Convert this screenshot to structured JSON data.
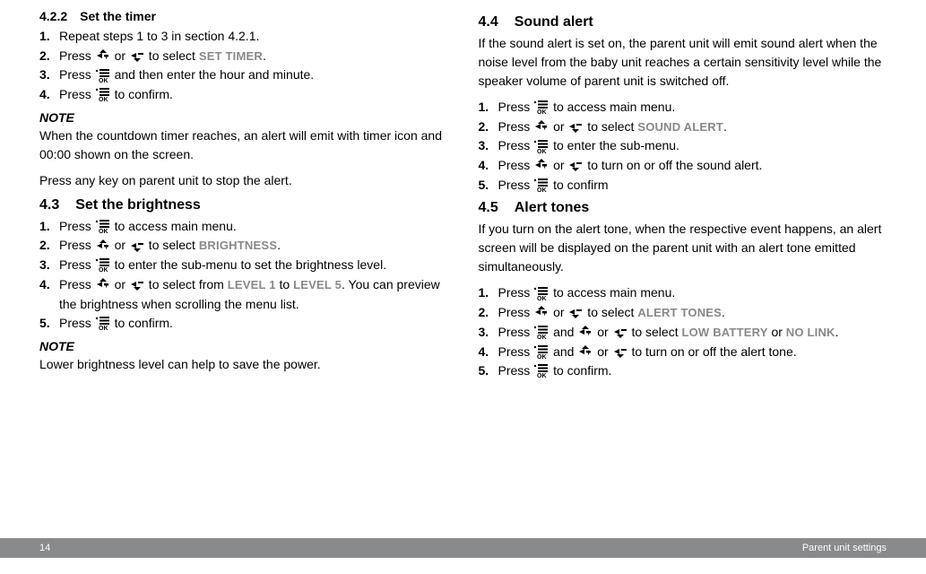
{
  "left": {
    "s422": {
      "num": "4.2.2",
      "title": "Set the timer",
      "steps": [
        {
          "n": "1.",
          "parts": [
            {
              "t": "Repeat steps 1 to 3 in section 4.2.1."
            }
          ]
        },
        {
          "n": "2.",
          "parts": [
            {
              "t": "Press "
            },
            {
              "icon": "up"
            },
            {
              "t": " or "
            },
            {
              "icon": "down"
            },
            {
              "t": " to select "
            },
            {
              "m": "SET TIMER"
            },
            {
              "t": "."
            }
          ]
        },
        {
          "n": "3.",
          "parts": [
            {
              "t": "Press "
            },
            {
              "icon": "ok"
            },
            {
              "t": " and then enter the hour and minute."
            }
          ]
        },
        {
          "n": "4.",
          "parts": [
            {
              "t": "Press "
            },
            {
              "icon": "ok"
            },
            {
              "t": " to confirm."
            }
          ]
        }
      ],
      "noteLabel": "NOTE",
      "noteText": "When the countdown timer reaches, an alert will emit with timer icon and 00:00 shown on the screen.",
      "noteText2": "Press any key on parent unit to stop the alert."
    },
    "s43": {
      "num": "4.3",
      "title": "Set the brightness",
      "steps": [
        {
          "n": "1.",
          "parts": [
            {
              "t": "Press "
            },
            {
              "icon": "ok"
            },
            {
              "t": " to access main menu."
            }
          ]
        },
        {
          "n": "2.",
          "parts": [
            {
              "t": "Press "
            },
            {
              "icon": "up"
            },
            {
              "t": " or "
            },
            {
              "icon": "down"
            },
            {
              "t": " to select "
            },
            {
              "m": "BRIGHTNESS"
            },
            {
              "t": "."
            }
          ]
        },
        {
          "n": "3.",
          "parts": [
            {
              "t": "Press "
            },
            {
              "icon": "ok"
            },
            {
              "t": " to enter the sub-menu to set the brightness level."
            }
          ]
        },
        {
          "n": "4.",
          "parts": [
            {
              "t": "Press "
            },
            {
              "icon": "up"
            },
            {
              "t": " or "
            },
            {
              "icon": "down"
            },
            {
              "t": " to select from "
            },
            {
              "m": "LEVEL 1"
            },
            {
              "t": " to "
            },
            {
              "m": "LEVEL 5"
            },
            {
              "t": ". You can preview the brightness when scrolling the menu list."
            }
          ]
        },
        {
          "n": "5.",
          "parts": [
            {
              "t": "Press "
            },
            {
              "icon": "ok"
            },
            {
              "t": " to confirm."
            }
          ]
        }
      ],
      "noteLabel": "NOTE",
      "noteText": "Lower brightness level can help to save the power."
    }
  },
  "right": {
    "s44": {
      "num": "4.4",
      "title": "Sound alert",
      "intro": "If the sound alert is set on, the parent unit will emit sound alert when the noise level from the baby unit reaches a certain sensitivity level while the speaker volume of parent unit is switched off.",
      "steps": [
        {
          "n": "1.",
          "parts": [
            {
              "t": "Press "
            },
            {
              "icon": "ok"
            },
            {
              "t": " to access main menu."
            }
          ]
        },
        {
          "n": "2.",
          "parts": [
            {
              "t": "Press "
            },
            {
              "icon": "up"
            },
            {
              "t": " or "
            },
            {
              "icon": "down"
            },
            {
              "t": " to select "
            },
            {
              "m": "SOUND ALERT"
            },
            {
              "t": "."
            }
          ]
        },
        {
          "n": "3.",
          "parts": [
            {
              "t": "Press "
            },
            {
              "icon": "ok"
            },
            {
              "t": " to enter the sub-menu."
            }
          ]
        },
        {
          "n": "4.",
          "parts": [
            {
              "t": "Press "
            },
            {
              "icon": "up"
            },
            {
              "t": " or "
            },
            {
              "icon": "down"
            },
            {
              "t": " to turn on or off the sound alert."
            }
          ]
        },
        {
          "n": "5.",
          "parts": [
            {
              "t": "Press "
            },
            {
              "icon": "ok"
            },
            {
              "t": " to confirm"
            }
          ]
        }
      ]
    },
    "s45": {
      "num": "4.5",
      "title": "Alert tones",
      "intro": "If you turn on the alert tone, when the respective event happens, an alert screen will be displayed on the parent unit with an alert tone emitted simultaneously.",
      "steps": [
        {
          "n": "1.",
          "parts": [
            {
              "t": "Press "
            },
            {
              "icon": "ok"
            },
            {
              "t": " to access main menu."
            }
          ]
        },
        {
          "n": "2.",
          "parts": [
            {
              "t": "Press "
            },
            {
              "icon": "up"
            },
            {
              "t": " or "
            },
            {
              "icon": "down"
            },
            {
              "t": " to select "
            },
            {
              "m": "ALERT TONES"
            },
            {
              "t": "."
            }
          ]
        },
        {
          "n": "3.",
          "parts": [
            {
              "t": "Press "
            },
            {
              "icon": "ok"
            },
            {
              "t": " and "
            },
            {
              "icon": "up"
            },
            {
              "t": " or "
            },
            {
              "icon": "down"
            },
            {
              "t": " to select "
            },
            {
              "m": "LOW BATTERY"
            },
            {
              "t": " or "
            },
            {
              "m": "NO LINK"
            },
            {
              "t": "."
            }
          ]
        },
        {
          "n": "4.",
          "parts": [
            {
              "t": "Press "
            },
            {
              "icon": "ok"
            },
            {
              "t": " and "
            },
            {
              "icon": "up"
            },
            {
              "t": " or "
            },
            {
              "icon": "down"
            },
            {
              "t": " to turn on or off the alert tone."
            }
          ]
        },
        {
          "n": "5.",
          "parts": [
            {
              "t": "Press "
            },
            {
              "icon": "ok"
            },
            {
              "t": " to confirm."
            }
          ]
        }
      ]
    }
  },
  "footer": {
    "pageNum": "14",
    "section": "Parent unit settings"
  }
}
